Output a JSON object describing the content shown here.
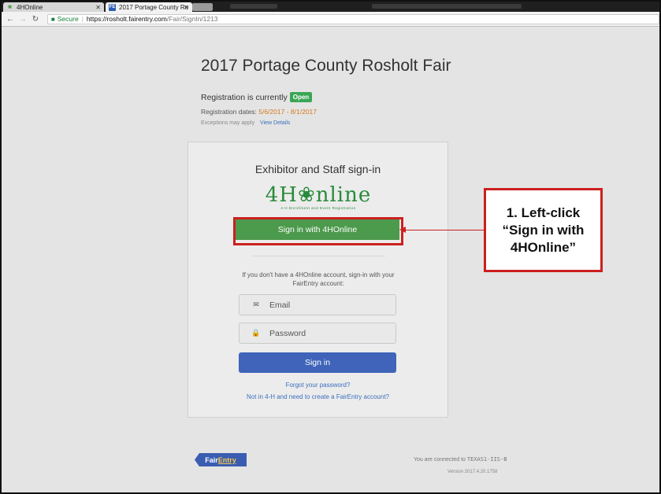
{
  "browser": {
    "tabs": [
      {
        "label": "4HOnline",
        "icon": "4h-clover-icon"
      },
      {
        "label": "2017 Portage County Ro",
        "icon": "fairentry-icon"
      }
    ],
    "secure_label": "Secure",
    "url_host": "https://rosholt.fairentry.com",
    "url_path": "/Fair/SignIn/1213"
  },
  "page": {
    "title": "2017 Portage County Rosholt Fair",
    "registration_text": "Registration is currently",
    "registration_status": "Open",
    "dates_label": "Registration dates:",
    "dates_value": "5/6/2017 - 8/1/2017",
    "exceptions_text": "Exceptions may apply",
    "view_details": "View Details"
  },
  "signin": {
    "heading": "Exhibitor and Staff sign-in",
    "logo_text": "4H❀nline",
    "logo_tag": "4-H Enrollment and Event Registration",
    "btn_4honline": "Sign in with 4HOnline",
    "info_text": "If you don't have a 4HOnline account, sign-in with your FairEntry account:",
    "email_placeholder": "Email",
    "password_placeholder": "Password",
    "btn_signin": "Sign in",
    "forgot_link": "Forgot your password?",
    "create_link": "Not in 4-H and need to create a FairEntry account?"
  },
  "footer": {
    "logo_fair": "Fair",
    "logo_entry": "Entry",
    "connected_text": "You are connected to",
    "server_name": "TEXAS1-IIS-B",
    "version": "Version 2017.4.20.1758"
  },
  "annotation": {
    "line1": "1. Left-click",
    "line2": "“Sign in with",
    "line3": "4HOnline”"
  },
  "colors": {
    "accent_green": "#4c9a4c",
    "accent_blue": "#3f64b9",
    "highlight_red": "#cc1f1f"
  }
}
